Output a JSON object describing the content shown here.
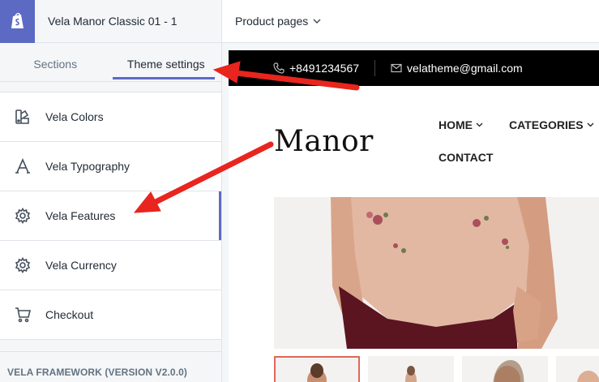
{
  "editor": {
    "theme_name": "Vela Manor Classic 01 - 1",
    "page_selector": "Product pages",
    "tabs": [
      {
        "label": "Sections"
      },
      {
        "label": "Theme settings"
      }
    ],
    "menu": [
      {
        "label": "Vela Colors",
        "icon": "palette-icon"
      },
      {
        "label": "Vela Typography",
        "icon": "typography-icon"
      },
      {
        "label": "Vela Features",
        "icon": "gear-icon"
      },
      {
        "label": "Vela Currency",
        "icon": "gear-icon"
      },
      {
        "label": "Checkout",
        "icon": "cart-icon"
      }
    ],
    "framework_label": "VELA FRAMEWORK (VERSION V2.0.0)"
  },
  "store": {
    "phone": "+8491234567",
    "email": "velatheme@gmail.com",
    "logo_text": "Manor",
    "nav": [
      {
        "label": "HOME"
      },
      {
        "label": "CATEGORIES"
      },
      {
        "label": "CONTACT"
      }
    ]
  },
  "colors": {
    "accent": "#5c6ac4",
    "annotation_arrow": "#e8251e",
    "thumb_active_border": "#e0675a"
  }
}
